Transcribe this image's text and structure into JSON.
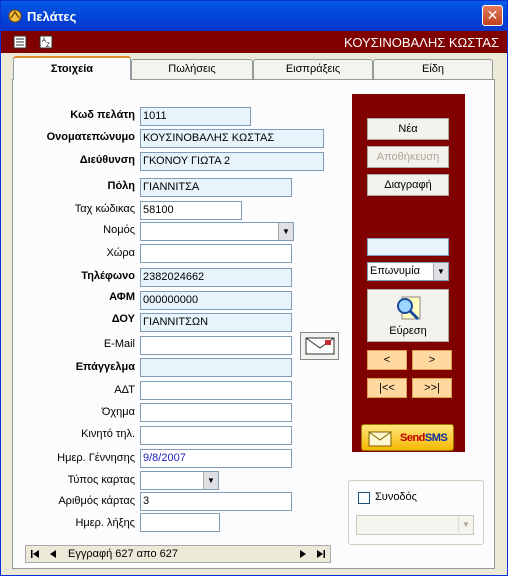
{
  "window": {
    "title": "Πελάτες",
    "close_glyph": "✕",
    "customer_header": "ΚΟΥΣΙΝΟΒΑΛΗΣ ΚΩΣΤΑΣ"
  },
  "tabs": [
    {
      "label": "Στοιχεία",
      "active": true
    },
    {
      "label": "Πωλήσεις",
      "active": false
    },
    {
      "label": "Εισπράξεις",
      "active": false
    },
    {
      "label": "Είδη",
      "active": false
    }
  ],
  "form": {
    "customer_code": {
      "label": "Κωδ πελάτη",
      "value": "1011"
    },
    "full_name": {
      "label": "Ονοματεπώνυμο",
      "value": "ΚΟΥΣΙΝΟΒΑΛΗΣ ΚΩΣΤΑΣ"
    },
    "address": {
      "label": "Διεύθυνση",
      "value": "ΓΚΟΝΟΥ ΓΙΩΤΑ 2"
    },
    "city": {
      "label": "Πόλη",
      "value": "ΓΙΑΝΝΙΤΣΑ"
    },
    "postal_code": {
      "label": "Ταχ κώδικας",
      "value": "58100"
    },
    "prefecture": {
      "label": "Νομός",
      "value": ""
    },
    "country": {
      "label": "Χώρα",
      "value": ""
    },
    "phone": {
      "label": "Τηλέφωνο",
      "value": "2382024662"
    },
    "vat": {
      "label": "ΑΦΜ",
      "value": "000000000"
    },
    "tax_office": {
      "label": "ΔΟΥ",
      "value": "ΓΙΑΝΝΙΤΣΩΝ"
    },
    "email": {
      "label": "E-Mail",
      "value": ""
    },
    "profession": {
      "label": "Επάγγελμα",
      "value": ""
    },
    "id_number": {
      "label": "ΑΔΤ",
      "value": ""
    },
    "vehicle": {
      "label": "Όχημα",
      "value": ""
    },
    "mobile": {
      "label": "Κινητό τηλ.",
      "value": ""
    },
    "birth_date": {
      "label": "Ημερ. Γέννησης",
      "value": "9/8/2007"
    },
    "card_type": {
      "label": "Τύπος καρτας",
      "value": ""
    },
    "card_number": {
      "label": "Αριθμός κάρτας",
      "value": "3"
    },
    "expiry_date": {
      "label": "Ημερ. λήξης",
      "value": ""
    }
  },
  "actions": {
    "new": "Νέα",
    "save": "Αποθήκευση",
    "delete": "Διαγραφή"
  },
  "search": {
    "query": "",
    "field": "Επωνυμία",
    "button": "Εύρεση"
  },
  "nav": {
    "prev": "<",
    "next": ">",
    "first": "|<<",
    "last": ">>|"
  },
  "sms": {
    "label_send": "Send",
    "label_sms": "SMS"
  },
  "companion": {
    "label": "Συνοδός",
    "checked": false,
    "value": ""
  },
  "record_nav": {
    "text": "Εγγραφή 627 απο 627"
  },
  "colors": {
    "accent": "#800000",
    "titlebar": "#0a5ae8"
  }
}
